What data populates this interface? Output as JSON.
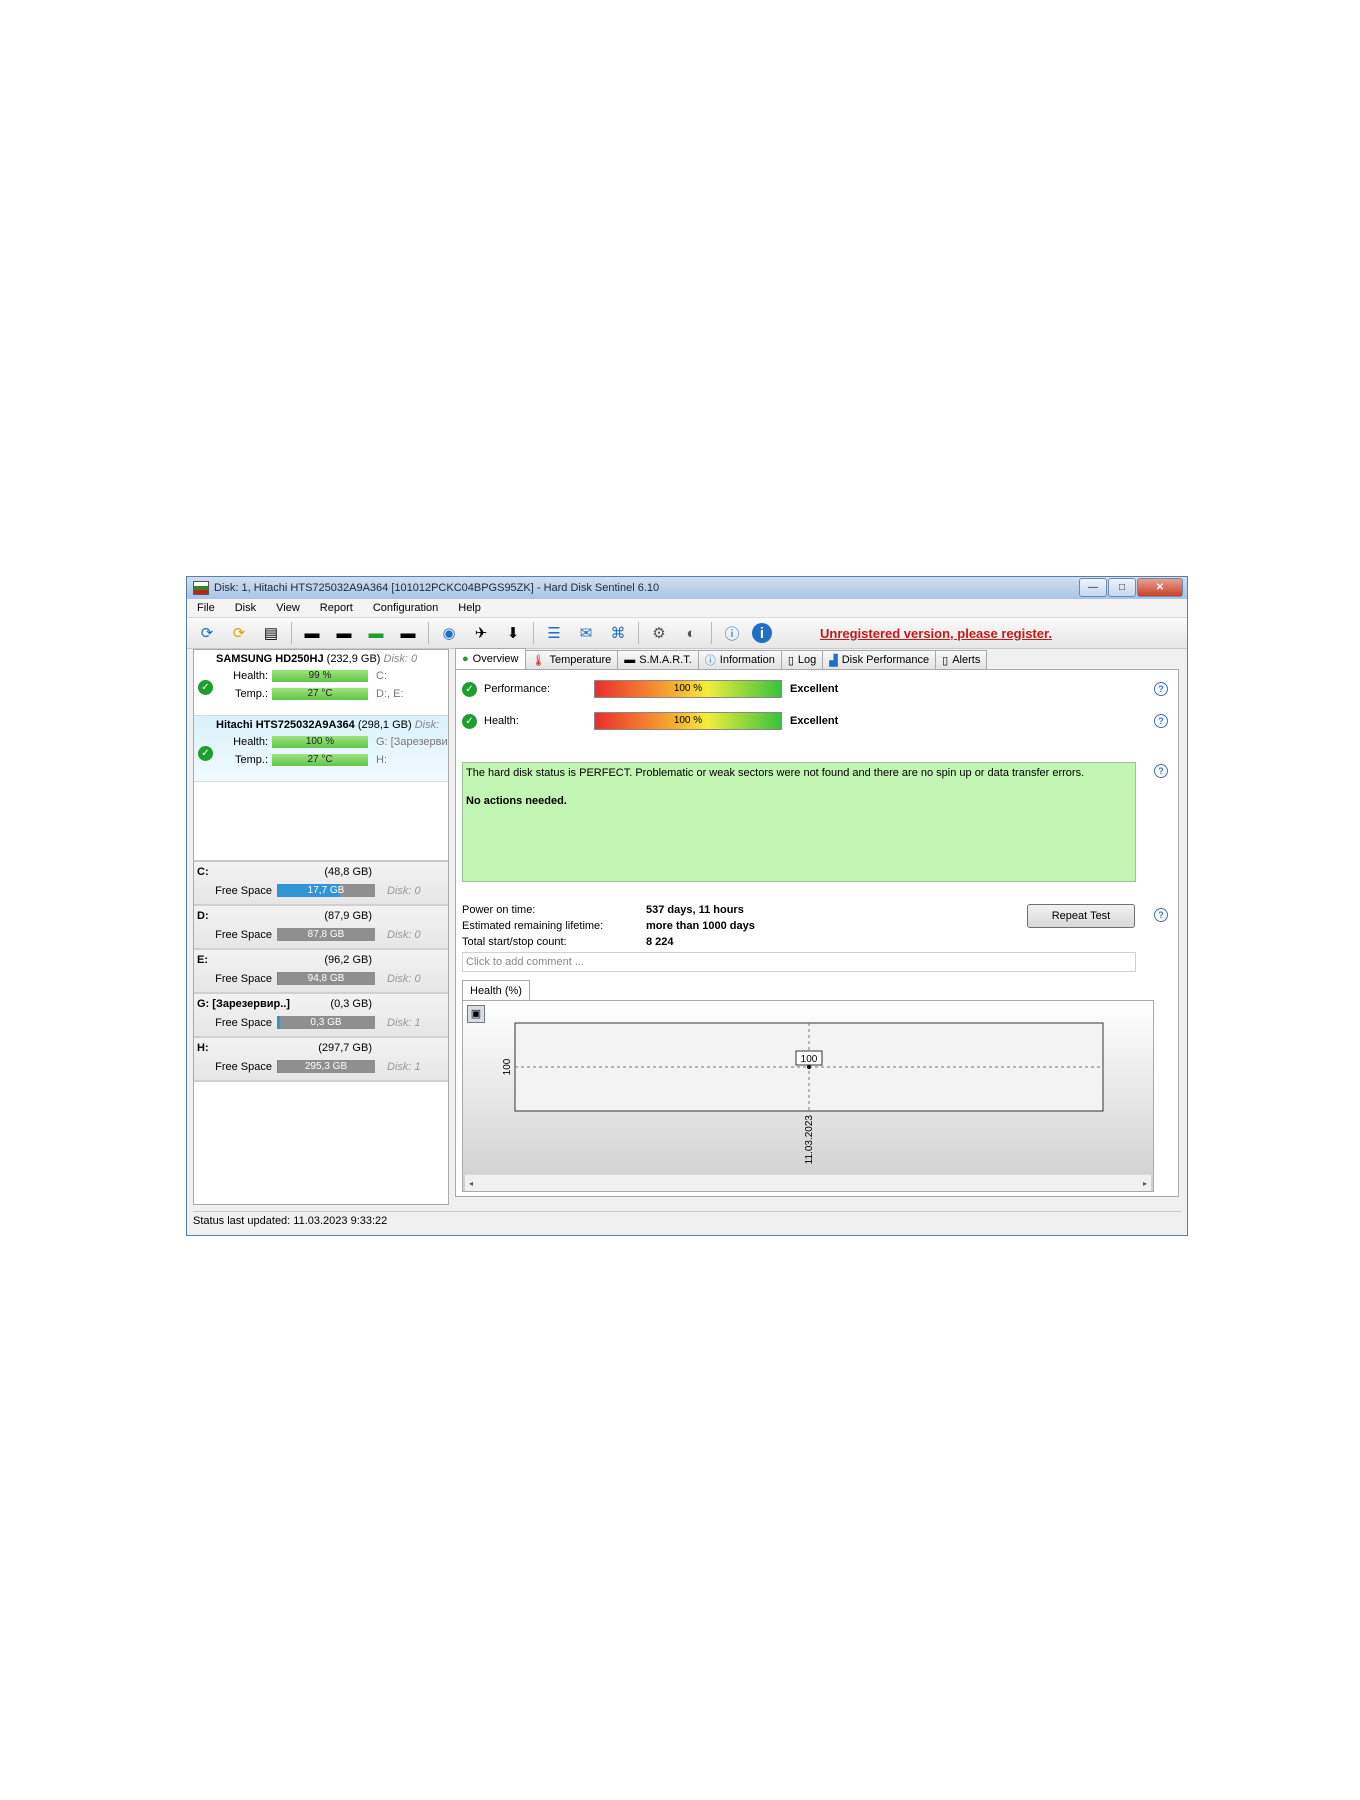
{
  "window": {
    "title": "Disk: 1, Hitachi HTS725032A9A364 [101012PCKC04BPGS95ZK]  -  Hard Disk Sentinel 6.10",
    "btn_min": "—",
    "btn_max": "□",
    "btn_close": "✕"
  },
  "menu": [
    "File",
    "Disk",
    "View",
    "Report",
    "Configuration",
    "Help"
  ],
  "toolbar": {
    "register_link": "Unregistered version, please register.",
    "icons": [
      "refresh-icon",
      "refresh-warning-icon",
      "disk-icon",
      "disk-check-icon",
      "disk-timer-icon",
      "disk-ok-icon",
      "disk-search-icon",
      "globe-icon",
      "satellite-icon",
      "disk-send-icon",
      "notes-icon",
      "mail-icon",
      "network-icon",
      "gear-icon",
      "sound-icon",
      "help-icon",
      "info-icon"
    ]
  },
  "disks": [
    {
      "name": "SAMSUNG HD250HJ",
      "size": "(232,9 GB)",
      "disk": "Disk: 0",
      "health_label": "Health:",
      "health": "99 %",
      "health_value": 99,
      "temp_label": "Temp.:",
      "temp": "27 °C",
      "drives1": "C:",
      "drives2": "D:, E:"
    },
    {
      "name": "Hitachi HTS725032A9A364",
      "size": "(298,1 GB)",
      "disk": "Disk:",
      "health_label": "Health:",
      "health": "100 %",
      "health_value": 100,
      "temp_label": "Temp.:",
      "temp": "27 °C",
      "drives1": "G: [Зарезервировано системой]",
      "drives2": "H:"
    }
  ],
  "volumes": [
    {
      "letter": "C:",
      "size": "(48,8 GB)",
      "free_label": "Free Space",
      "free": "17,7 GB",
      "used_pct": 64,
      "disk": "Disk: 0"
    },
    {
      "letter": "D:",
      "size": "(87,9 GB)",
      "free_label": "Free Space",
      "free": "87,8 GB",
      "used_pct": 0,
      "disk": "Disk: 0"
    },
    {
      "letter": "E:",
      "size": "(96,2 GB)",
      "free_label": "Free Space",
      "free": "94,8 GB",
      "used_pct": 1,
      "disk": "Disk: 0"
    },
    {
      "letter": "G: [Зарезервир..]",
      "size": "(0,3 GB)",
      "free_label": "Free Space",
      "free": "0,3 GB",
      "used_pct": 3,
      "disk": "Disk: 1"
    },
    {
      "letter": "H:",
      "size": "(297,7 GB)",
      "free_label": "Free Space",
      "free": "295,3 GB",
      "used_pct": 1,
      "disk": "Disk: 1"
    }
  ],
  "tabs": [
    {
      "label": "Overview",
      "icon": "check-icon"
    },
    {
      "label": "Temperature",
      "icon": "thermometer-icon"
    },
    {
      "label": "S.M.A.R.T.",
      "icon": "disk-icon"
    },
    {
      "label": "Information",
      "icon": "info-icon"
    },
    {
      "label": "Log",
      "icon": "page-icon"
    },
    {
      "label": "Disk Performance",
      "icon": "chart-icon"
    },
    {
      "label": "Alerts",
      "icon": "alert-page-icon"
    }
  ],
  "overview": {
    "performance_label": "Performance:",
    "performance": "100 %",
    "performance_result": "Excellent",
    "health_label": "Health:",
    "health": "100 %",
    "health_result": "Excellent",
    "status_text": "The hard disk status is PERFECT. Problematic or weak sectors were not found and there are no spin up or data transfer errors.",
    "actions_text": "No actions needed.",
    "info": [
      {
        "key": "Power on time:",
        "value": "537 days, 11 hours"
      },
      {
        "key": "Estimated remaining lifetime:",
        "value": "more than 1000 days"
      },
      {
        "key": "Total start/stop count:",
        "value": "8 224"
      }
    ],
    "repeat_button": "Repeat Test",
    "comment_placeholder": "Click to add comment ...",
    "chart_tab": "Health (%)"
  },
  "chart_data": {
    "type": "line",
    "title": "Health (%)",
    "x": [
      "11.03.2023"
    ],
    "series": [
      {
        "values": [
          100
        ]
      }
    ],
    "ytick": "100",
    "point_label": "100"
  },
  "statusbar": "Status last updated: 11.03.2023 9:33:22"
}
